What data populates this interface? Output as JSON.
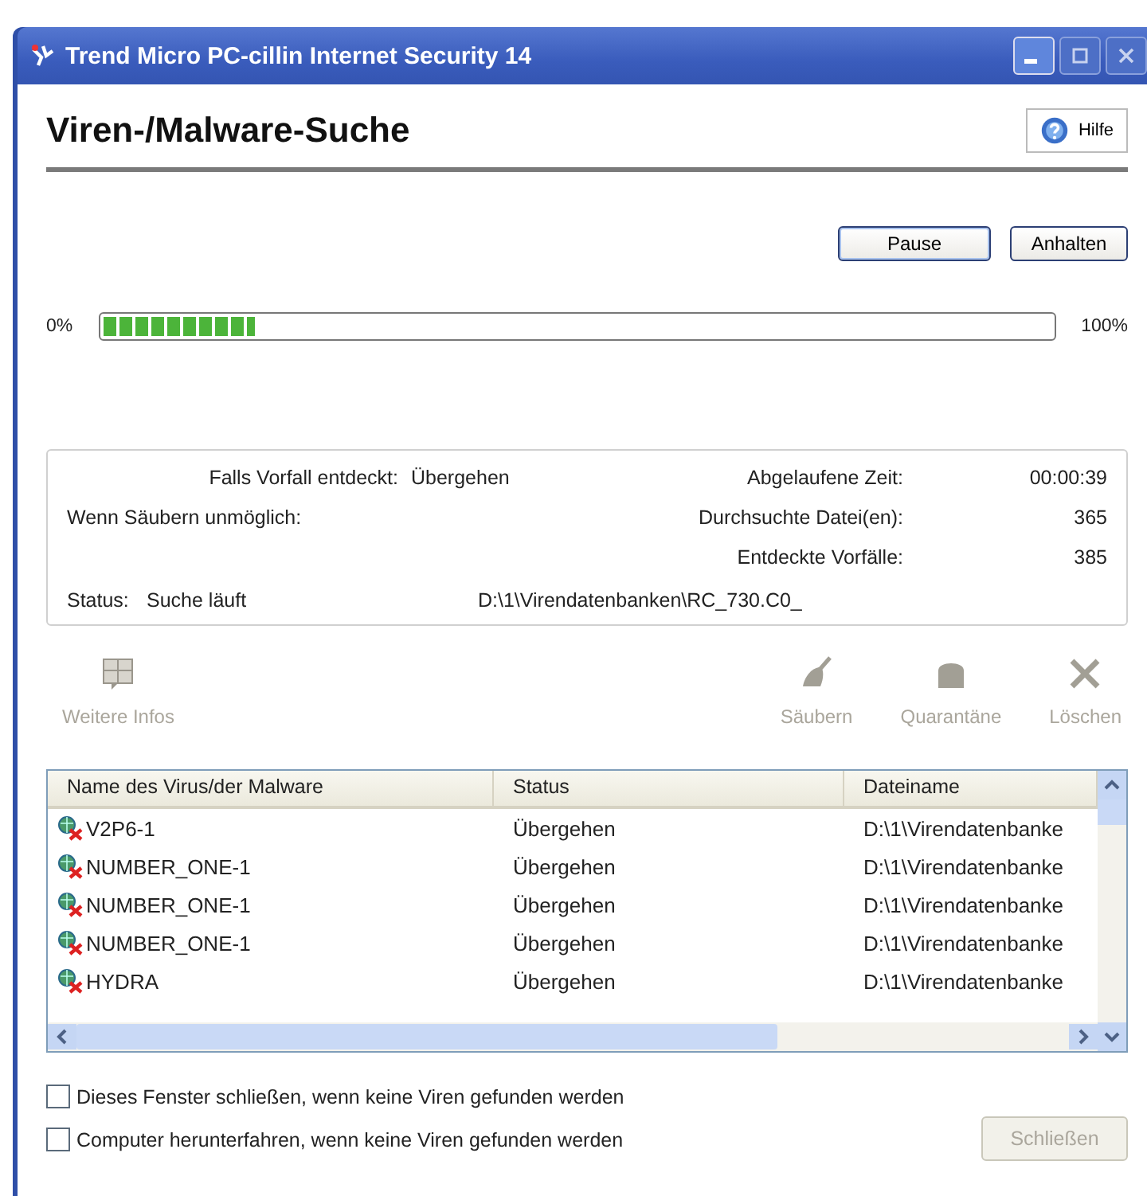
{
  "window": {
    "title": "Trend Micro PC-cillin Internet Security 14"
  },
  "header": {
    "title": "Viren-/Malware-Suche",
    "help_button": "Hilfe"
  },
  "scan_buttons": [
    {
      "label": "Pause",
      "kind": "default"
    },
    {
      "label": "Anhalten",
      "kind": "normal"
    }
  ],
  "progress": {
    "min_label": "0%",
    "max_label": "100%",
    "level": 0.16
  },
  "info": {
    "left": [
      {
        "label": "Falls Vorfall entdeckt:",
        "value": "Übergehen"
      },
      {
        "label": "Wenn Säubern unmöglich:"
      }
    ],
    "right": [
      {
        "label": "Abgelaufene Zeit:",
        "value": "00:00:39"
      },
      {
        "label": "Durchsuchte Datei(en):",
        "value": "365"
      },
      {
        "label": "Entdeckte Vorfälle:",
        "value": "385"
      }
    ],
    "status_label": "Status:",
    "status_value": "Suche läuft",
    "current_file": "D:\\1\\Virendatenbanken\\RC_730.C0_"
  },
  "toolbar": [
    {
      "label": "Weitere Infos",
      "kind": "info",
      "disabled": true
    },
    {
      "label": "Säubern",
      "kind": "clean",
      "disabled": true
    },
    {
      "label": "Quarantäne",
      "kind": "quarantine",
      "disabled": true
    },
    {
      "label": "Löschen",
      "kind": "delete",
      "disabled": true
    }
  ],
  "table": {
    "columns": [
      "Name des Virus/der Malware",
      "Status",
      "Dateiname"
    ],
    "rows": [
      [
        "V2P6-1",
        "Übergehen",
        "D:\\1\\Virendatenbanke"
      ],
      [
        "NUMBER_ONE-1",
        "Übergehen",
        "D:\\1\\Virendatenbanke"
      ],
      [
        "NUMBER_ONE-1",
        "Übergehen",
        "D:\\1\\Virendatenbanke"
      ],
      [
        "NUMBER_ONE-1",
        "Übergehen",
        "D:\\1\\Virendatenbanke"
      ],
      [
        "HYDRA",
        "Übergehen",
        "D:\\1\\Virendatenbanke"
      ]
    ]
  },
  "options": [
    {
      "label": "Dieses Fenster schließen, wenn keine Viren gefunden werden",
      "checked": false
    },
    {
      "label": "Computer herunterfahren, wenn keine Viren gefunden werden",
      "checked": false
    }
  ],
  "close_button": {
    "label": "Schließen",
    "disabled": true
  }
}
